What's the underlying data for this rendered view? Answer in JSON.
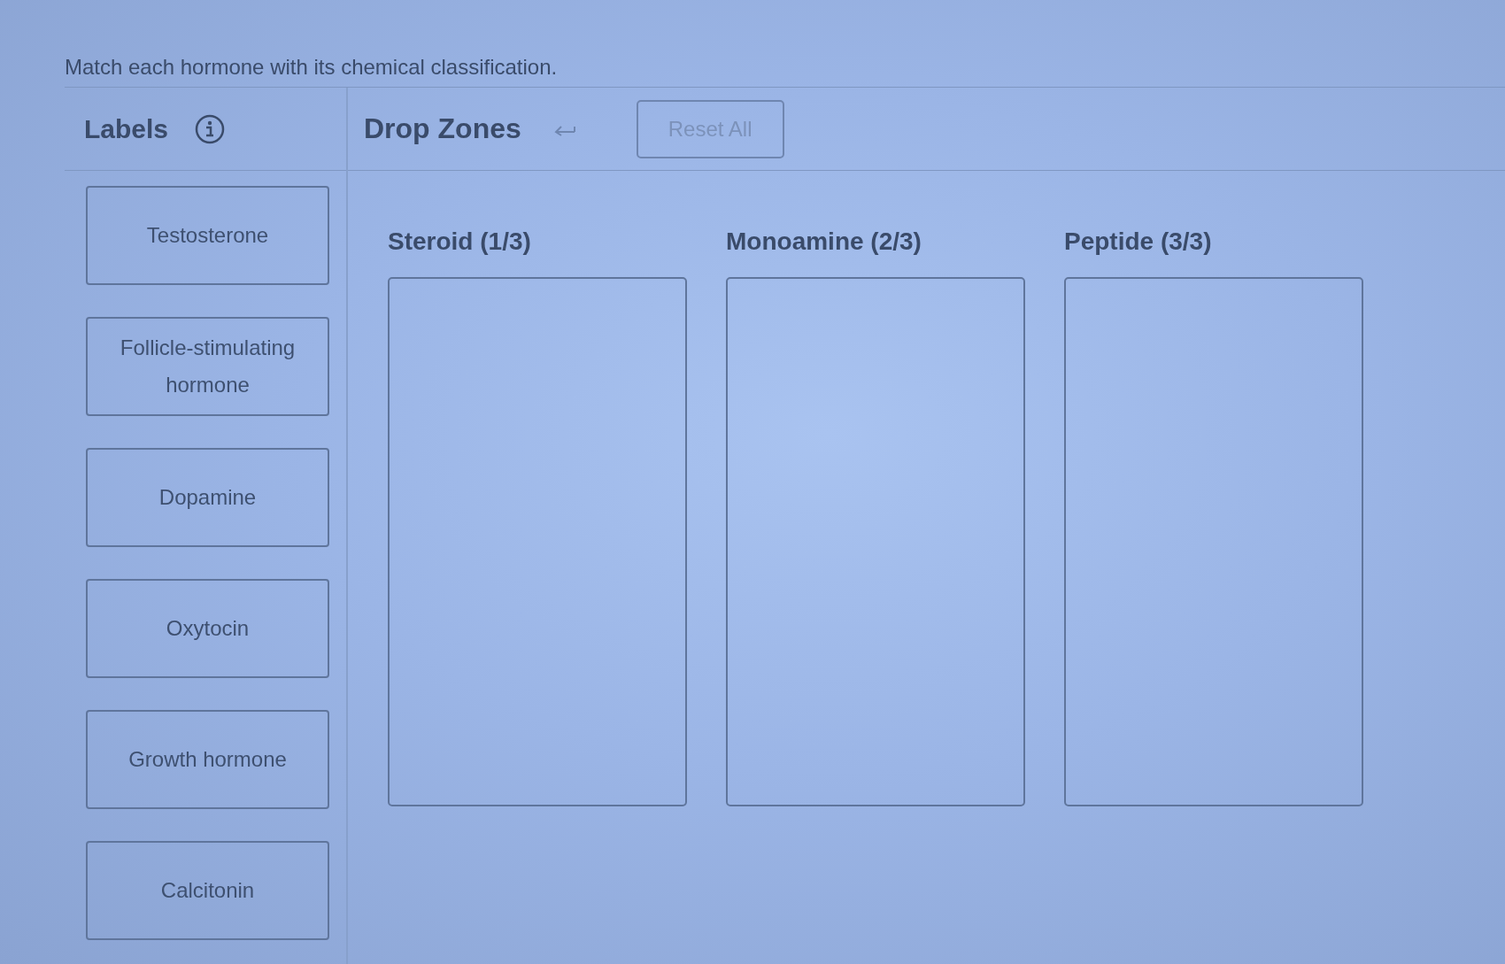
{
  "instruction": "Match each hormone with its chemical classification.",
  "labels_panel": {
    "title": "Labels",
    "labels": [
      "Testosterone",
      "Follicle-stimulating hormone",
      "Dopamine",
      "Oxytocin",
      "Growth hormone",
      "Calcitonin"
    ]
  },
  "drop_zones_panel": {
    "title": "Drop Zones",
    "reset_button": {
      "label": "Reset All",
      "disabled": true
    },
    "zones": [
      {
        "title": "Steroid (1/3)"
      },
      {
        "title": "Monoamine (2/3)"
      },
      {
        "title": "Peptide (3/3)"
      }
    ]
  }
}
